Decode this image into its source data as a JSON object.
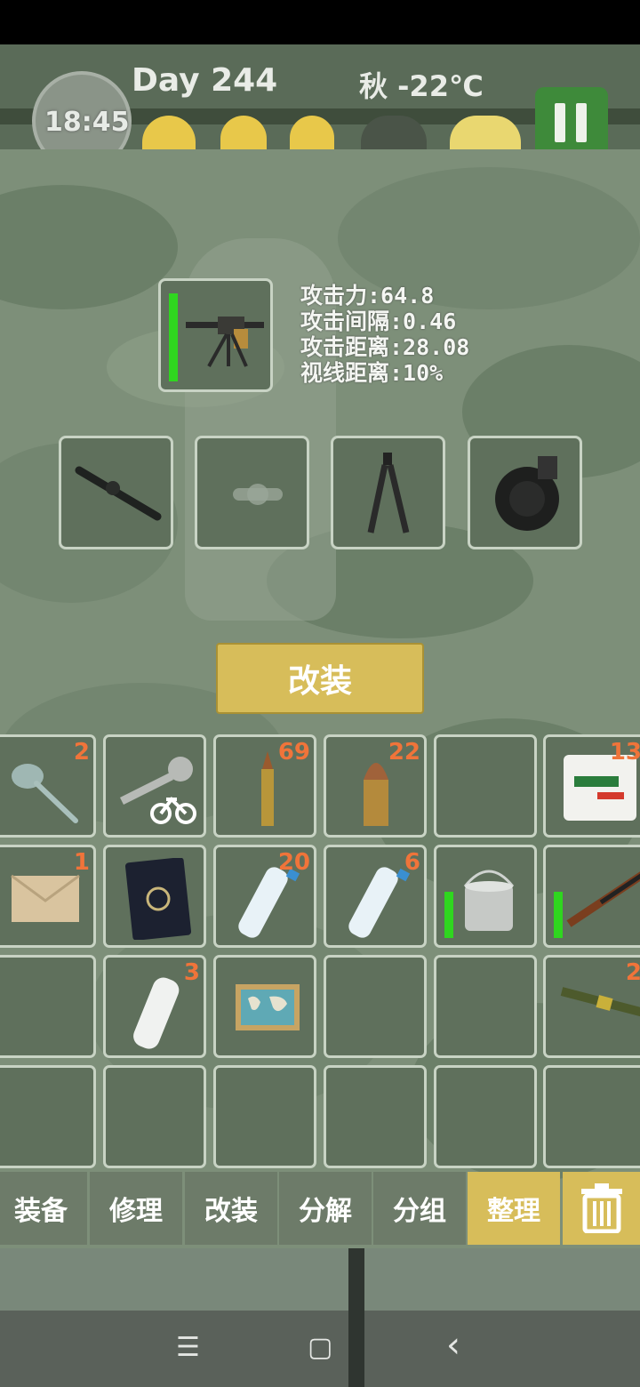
{
  "hud": {
    "time": "18:45",
    "day": "Day 244",
    "season_temp": "秋 -22℃",
    "pause_icon": "pause-icon"
  },
  "weapon": {
    "durability": 0.95,
    "stats": [
      "攻击力:64.8",
      "攻击间隔:0.46",
      "攻击距离:28.08",
      "视线距离:10%"
    ],
    "attachments": [
      "scope-icon",
      "empty-slot-icon",
      "bipod-icon",
      "drum-magazine-icon"
    ]
  },
  "modify_button": "改装",
  "inventory": {
    "row1": [
      {
        "icon": "spoon-icon",
        "count": "2"
      },
      {
        "icon": "bike-key-icon",
        "count": ""
      },
      {
        "icon": "rifle-bullet-icon",
        "count": "69"
      },
      {
        "icon": "pistol-bullet-icon",
        "count": "22"
      },
      {
        "icon": "",
        "count": ""
      },
      {
        "icon": "compressed-biscuit-icon",
        "count": "13"
      }
    ],
    "row2": [
      {
        "icon": "envelope-icon",
        "count": "1"
      },
      {
        "icon": "passport-icon",
        "count": ""
      },
      {
        "icon": "water-bottle-icon",
        "count": "20"
      },
      {
        "icon": "water-bottle-icon",
        "count": "6"
      },
      {
        "icon": "cooking-pot-icon",
        "count": ""
      },
      {
        "icon": "rifle-icon",
        "count": ""
      }
    ],
    "row3": [
      {
        "icon": "",
        "count": ""
      },
      {
        "icon": "empty-bottle-icon",
        "count": "3"
      },
      {
        "icon": "world-map-icon",
        "count": ""
      },
      {
        "icon": "",
        "count": ""
      },
      {
        "icon": "",
        "count": ""
      },
      {
        "icon": "rocket-launcher-icon",
        "count": "2"
      }
    ]
  },
  "toolbar": {
    "equip": "装备",
    "repair": "修理",
    "modify": "改装",
    "disassemble": "分解",
    "group": "分组",
    "sort": "整理",
    "trash_icon": "trash-icon"
  },
  "nav": {
    "menu": "☰",
    "home": "▢",
    "back": "‹"
  },
  "colors": {
    "accent": "#d7bd5a",
    "count_orange": "#f0743a",
    "durability_green": "#2fd61f"
  }
}
